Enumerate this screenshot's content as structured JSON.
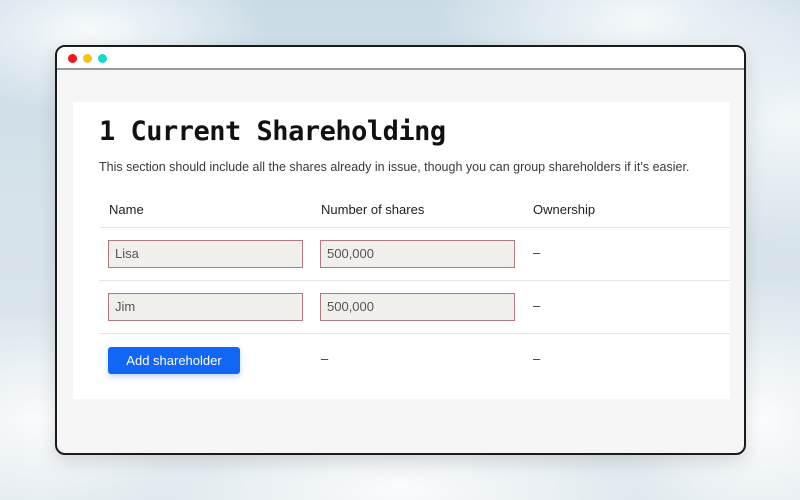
{
  "window": {
    "controls": [
      "close-icon",
      "minimize-icon",
      "maximize-icon"
    ]
  },
  "section": {
    "title": "1 Current Shareholding",
    "description": "This section should include all the shares already in issue, though you can group shareholders if it’s easier."
  },
  "table": {
    "headers": [
      "Name",
      "Number of shares",
      "Ownership"
    ],
    "rows": [
      {
        "name": "Lisa",
        "shares": "500,000",
        "ownership": "–"
      },
      {
        "name": "Jim",
        "shares": "500,000",
        "ownership": "–"
      }
    ],
    "footer": {
      "add_label": "Add shareholder",
      "total_shares": "–",
      "total_ownership": "–"
    }
  },
  "colors": {
    "accent": "#1166f5",
    "input_bg": "#f1efeb",
    "input_border": "#b07a80",
    "close": "#f5141b",
    "minimize": "#f7c31b",
    "maximize": "#16d8c6"
  }
}
